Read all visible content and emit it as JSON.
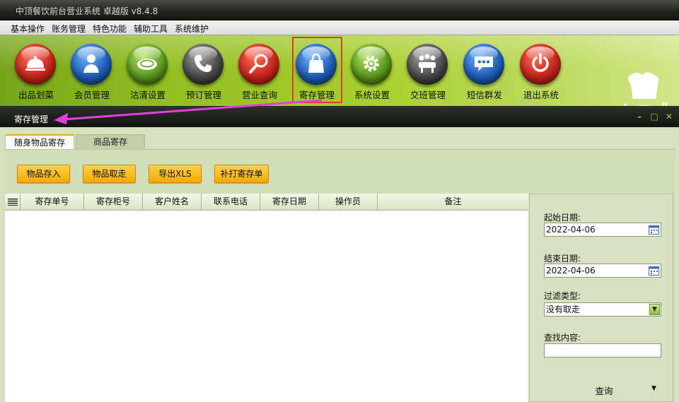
{
  "window": {
    "title": "中顶餐饮前台营业系统 卓越版 v8.4.8"
  },
  "menu": [
    {
      "label": "基本操作"
    },
    {
      "label": "账务管理"
    },
    {
      "label": "特色功能"
    },
    {
      "label": "辅助工具"
    },
    {
      "label": "系统维护"
    }
  ],
  "toolbar": [
    {
      "label": "出品划菜",
      "icon": "food-cloche-icon",
      "color": "#c7261c"
    },
    {
      "label": "会员管理",
      "icon": "member-person-icon",
      "color": "#1f5fb8"
    },
    {
      "label": "沽清设置",
      "icon": "empty-plate-icon",
      "color": "#5b9a1c"
    },
    {
      "label": "预订管理",
      "icon": "telephone-icon",
      "color": "#4a4a4a"
    },
    {
      "label": "营业查询",
      "icon": "magnifier-icon",
      "color": "#c7261c"
    },
    {
      "label": "寄存管理",
      "icon": "shopping-bag-icon",
      "color": "#1f5fb8"
    },
    {
      "label": "系统设置",
      "icon": "gear-icon",
      "color": "#5b9a1c"
    },
    {
      "label": "交班管理",
      "icon": "shift-meeting-icon",
      "color": "#4a4a4a"
    },
    {
      "label": "短信群发",
      "icon": "sms-bubble-icon",
      "color": "#1f5fb8"
    },
    {
      "label": "退出系统",
      "icon": "power-icon",
      "color": "#c7261c"
    }
  ],
  "subwindow": {
    "title": "寄存管理"
  },
  "tabs": [
    {
      "label": "随身物品寄存",
      "active": true
    },
    {
      "label": "商品寄存",
      "active": false
    }
  ],
  "actions": [
    {
      "label": "物品存入"
    },
    {
      "label": "物品取走"
    },
    {
      "label": "导出XLS"
    },
    {
      "label": "补打寄存单"
    }
  ],
  "table": {
    "columns": [
      "寄存单号",
      "寄存柜号",
      "客户姓名",
      "联系电话",
      "寄存日期",
      "操作员",
      "备注"
    ],
    "rows": []
  },
  "filters": {
    "start_label": "起始日期:",
    "start_value": "2022-04-06",
    "end_label": "结束日期:",
    "end_value": "2022-04-06",
    "type_label": "过滤类型:",
    "type_value": "没有取走",
    "search_label": "查找内容:",
    "search_value": "",
    "query_label": "查询"
  }
}
